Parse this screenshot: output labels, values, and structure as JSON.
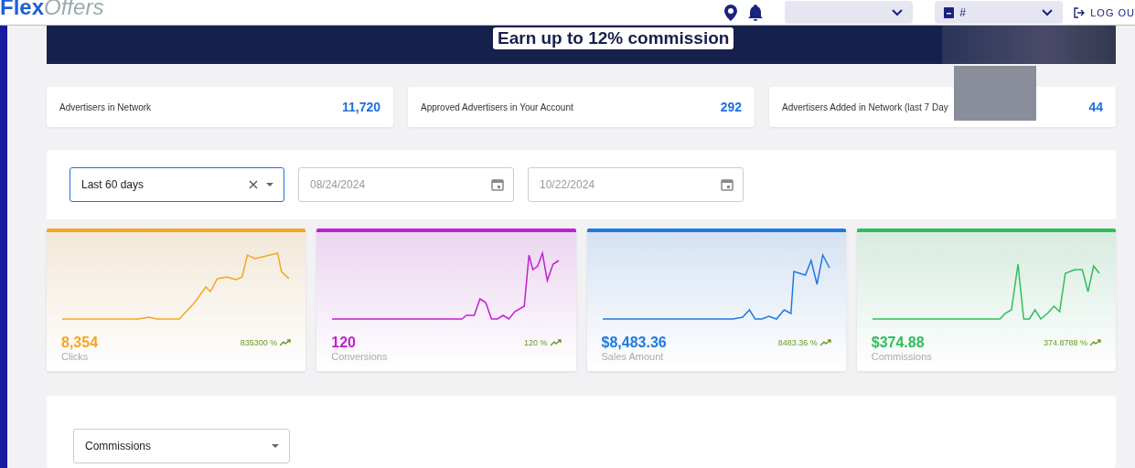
{
  "header": {
    "logo_first": "Flex",
    "logo_second": "Offers",
    "account_prefix": "#",
    "logout": "LOG OU"
  },
  "banner": {
    "tagline": "Earn up to 12% commission"
  },
  "stats": [
    {
      "label": "Advertisers in Network",
      "value": "11,720"
    },
    {
      "label": "Approved Advertisers in Your Account",
      "value": "292"
    },
    {
      "label": "Advertisers Added in Network (last 7 Day",
      "value": "44"
    }
  ],
  "filters": {
    "range": {
      "value": "Last 60 days"
    },
    "start_date": {
      "placeholder": "08/24/2024"
    },
    "end_date": {
      "placeholder": "10/22/2024"
    }
  },
  "kpis": [
    {
      "value": "8,354",
      "label": "Clicks",
      "change": "835300 %",
      "color": "#f5a623"
    },
    {
      "value": "120",
      "label": "Conversions",
      "change": "120 %",
      "color": "#c21fd1"
    },
    {
      "value": "$8,483.36",
      "label": "Sales Amount",
      "change": "8483.36 %",
      "color": "#1f7ae0"
    },
    {
      "value": "$374.88",
      "label": "Commissions",
      "change": "374.8788 %",
      "color": "#2fbf5a"
    }
  ],
  "metric_select": {
    "value": "Commissions"
  }
}
